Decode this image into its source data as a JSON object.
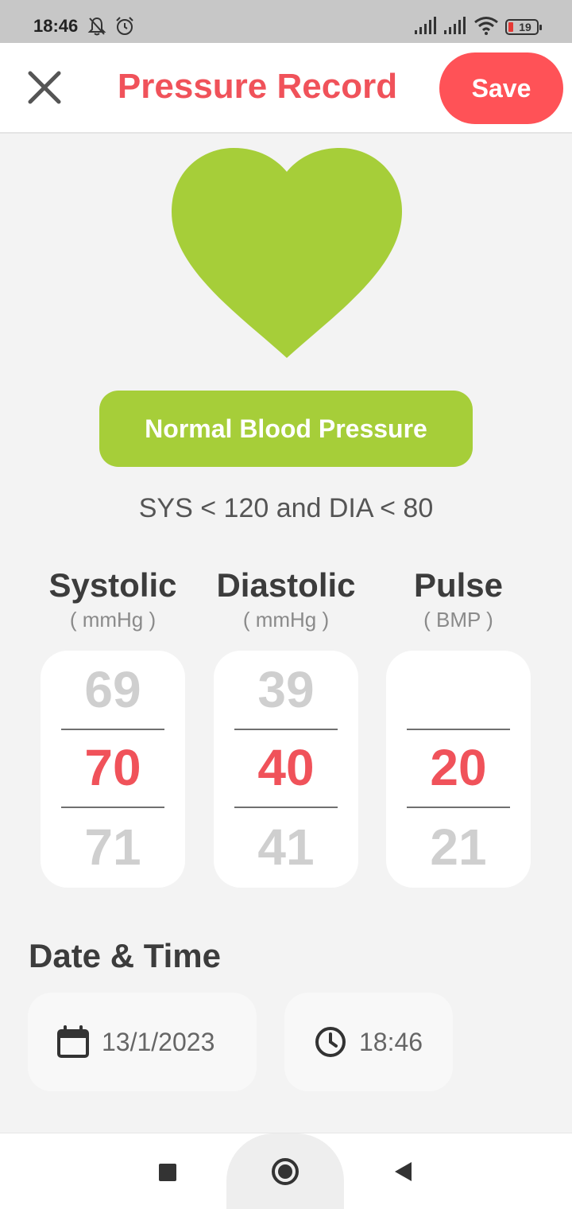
{
  "status_bar": {
    "time": "18:46",
    "battery": "19",
    "icons": [
      "bell-off-icon",
      "alarm-icon",
      "signal-icon",
      "signal-icon",
      "wifi-icon",
      "battery-icon"
    ]
  },
  "header": {
    "title": "Pressure Record",
    "save_label": "Save",
    "close_icon": "close-icon"
  },
  "colors": {
    "accent": "#f0525a",
    "save": "#ff5257",
    "normal_green": "#a6ce39"
  },
  "status": {
    "label": "Normal Blood Pressure",
    "range": "SYS < 120 and DIA < 80"
  },
  "pickers": {
    "systolic": {
      "title": "Systolic",
      "unit": "( mmHg )",
      "prev": "69",
      "current": "70",
      "next": "71"
    },
    "diastolic": {
      "title": "Diastolic",
      "unit": "( mmHg )",
      "prev": "39",
      "current": "40",
      "next": "41"
    },
    "pulse": {
      "title": "Pulse",
      "unit": "( BMP )",
      "prev": "",
      "current": "20",
      "next": "21"
    }
  },
  "datetime": {
    "title": "Date & Time",
    "date": "13/1/2023",
    "time": "18:46"
  },
  "nav": {
    "icons": [
      "recents-icon",
      "home-icon",
      "back-icon"
    ]
  }
}
